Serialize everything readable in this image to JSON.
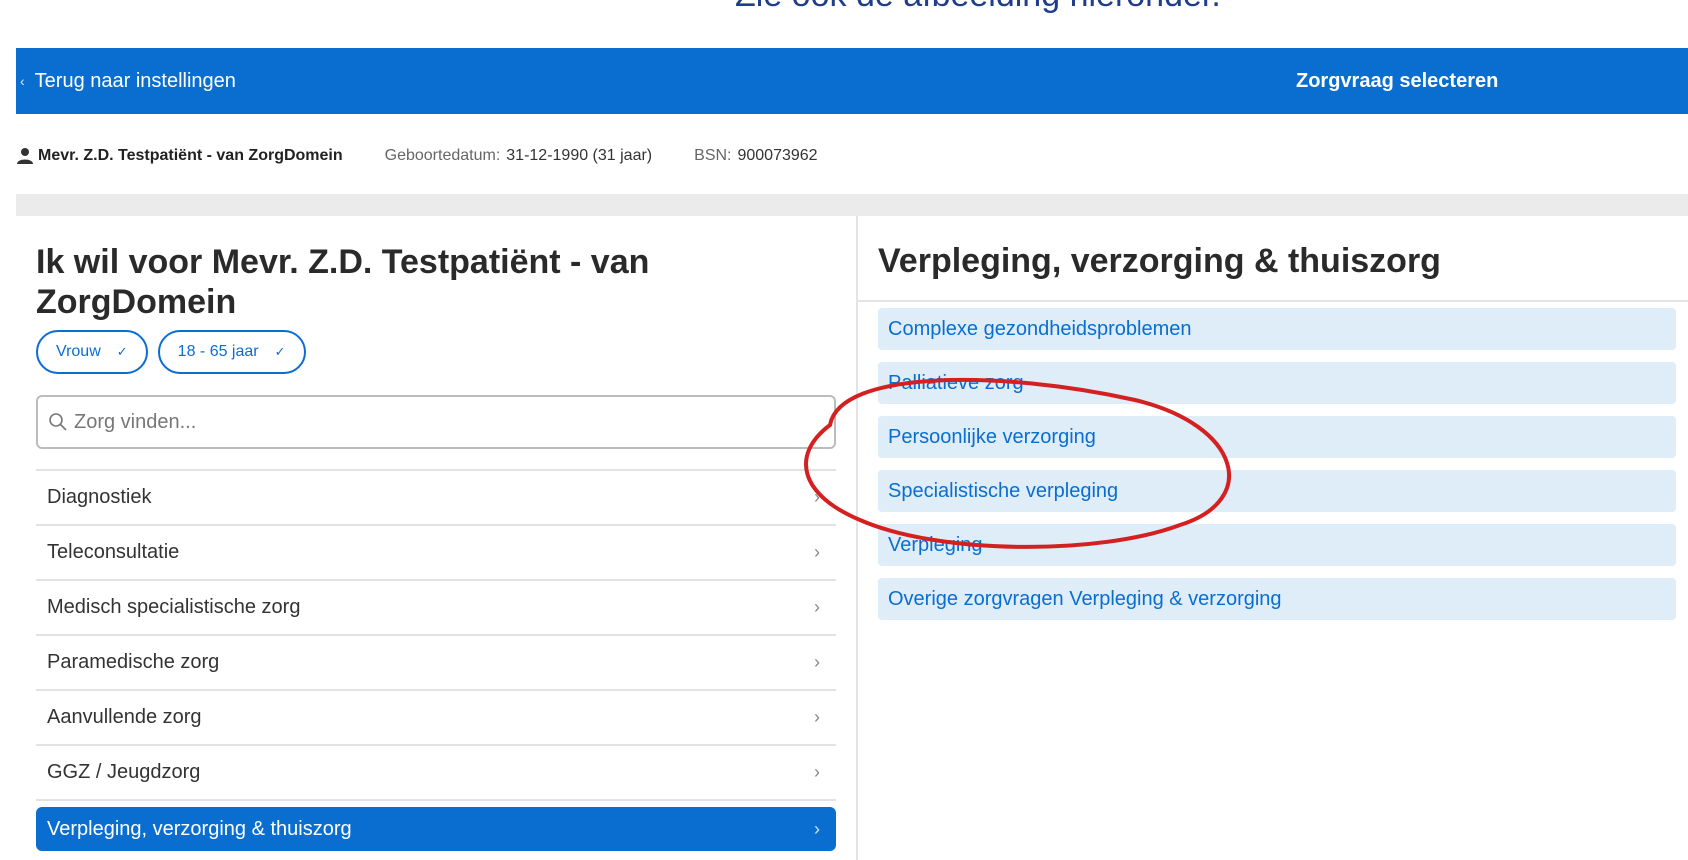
{
  "caption": "Zie ook de afbeelding hieronder.",
  "topbar": {
    "back_label": "Terug naar instellingen",
    "title": "Zorgvraag selecteren"
  },
  "patient": {
    "name": "Mevr. Z.D. Testpatiënt - van ZorgDomein",
    "dob_label": "Geboortedatum:",
    "dob_value": "31-12-1990 (31 jaar)",
    "bsn_label": "BSN:",
    "bsn_value": "900073962"
  },
  "left": {
    "heading": "Ik wil voor Mevr. Z.D. Testpatiënt - van ZorgDomein",
    "chips": [
      {
        "label": "Vrouw"
      },
      {
        "label": "18 - 65 jaar"
      }
    ],
    "search_placeholder": "Zorg vinden...",
    "categories": [
      {
        "label": "Diagnostiek"
      },
      {
        "label": "Teleconsultatie"
      },
      {
        "label": "Medisch specialistische zorg"
      },
      {
        "label": "Paramedische zorg"
      },
      {
        "label": "Aanvullende zorg"
      },
      {
        "label": "GGZ / Jeugdzorg"
      },
      {
        "label": "Verpleging, verzorging & thuiszorg",
        "selected": true
      }
    ]
  },
  "right": {
    "heading": "Verpleging, verzorging & thuiszorg",
    "options": [
      {
        "label": "Complexe gezondheidsproblemen"
      },
      {
        "label": "Palliatieve zorg"
      },
      {
        "label": "Persoonlijke verzorging"
      },
      {
        "label": "Specialistische verpleging"
      },
      {
        "label": "Verpleging"
      },
      {
        "label": "Overige zorgvragen Verpleging & verzorging"
      }
    ]
  },
  "colors": {
    "primary": "#0a6ed1",
    "option_bg": "#deedf8",
    "annotation": "#d42020"
  },
  "icons": {
    "back": "chevron-left-icon",
    "person": "person-icon",
    "search": "search-icon",
    "chip_check": "check-icon",
    "row_arrow": "chevron-right-icon"
  }
}
